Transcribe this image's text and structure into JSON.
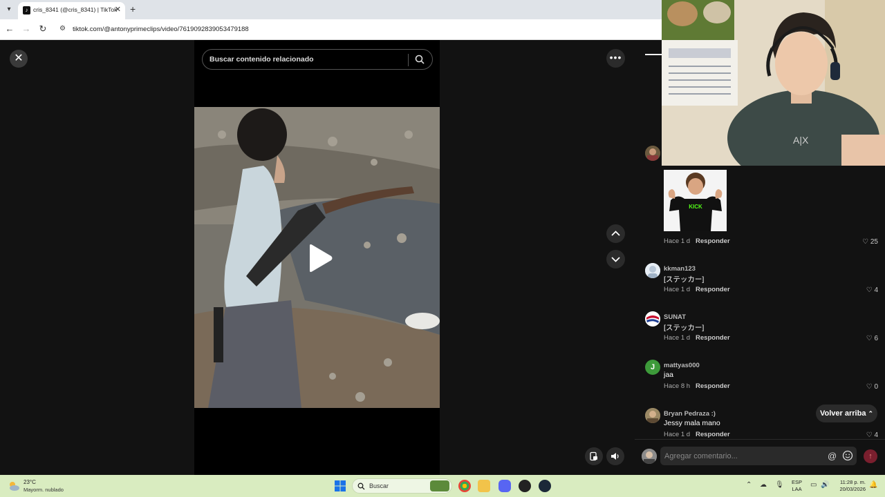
{
  "browser": {
    "tab_title": "cris_8341 (@cris_8341) | TikTok",
    "url": "tiktok.com/@antonyprimeclips/video/7619092839053479188",
    "tab_close": "✕",
    "new_tab": "+"
  },
  "player": {
    "search_placeholder": "Buscar contenido relacionado",
    "more_label": "•••"
  },
  "comments": [
    {
      "type": "sticker",
      "time": "Hace 1 d",
      "reply": "Responder",
      "likes": "25"
    },
    {
      "user": "kkman123",
      "text": "[ステッカー]",
      "time": "Hace 1 d",
      "reply": "Responder",
      "likes": "4"
    },
    {
      "user": "SUNAT",
      "text": "[ステッカー]",
      "time": "Hace 1 d",
      "reply": "Responder",
      "likes": "6"
    },
    {
      "user": "mattyas000",
      "text": "jaa",
      "time": "Hace 8 h",
      "reply": "Responder",
      "likes": "0"
    },
    {
      "user": "Bryan Pedraza :)",
      "text": "Jessy mala mano",
      "time": "Hace 1 d",
      "reply": "Responder",
      "likes": "4"
    }
  ],
  "avatar_initials": {
    "mattyas000": "J"
  },
  "sticker_text": "KICK",
  "back_to_top": "Volver arriba",
  "comment_input": {
    "placeholder": "Agregar comentario..."
  },
  "taskbar": {
    "weather_temp": "23°C",
    "weather_cond": "Mayorm. nublado",
    "search": "Buscar",
    "lang_top": "ESP",
    "lang_bottom": "LAA",
    "time": "11:28 p. m.",
    "date": "20/03/2026"
  },
  "colors": {
    "accent": "#fe2c55",
    "taskbar": "#d9ecc0",
    "panel": "#121212"
  }
}
